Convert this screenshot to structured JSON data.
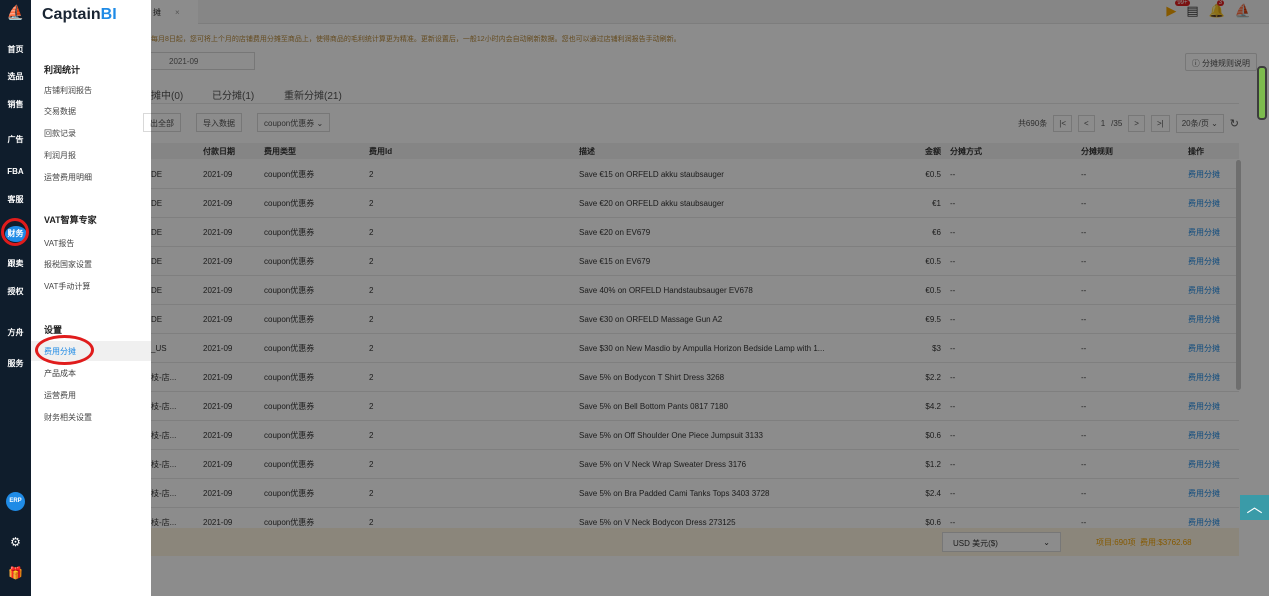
{
  "rail": {
    "items": [
      "首页",
      "选品",
      "销售",
      "广告",
      "FBA",
      "客服",
      "财务",
      "跟卖",
      "授权",
      "方舟",
      "服务"
    ],
    "erp": "ERP"
  },
  "panel": {
    "brand_main": "Captain",
    "brand_accent": "BI",
    "sections": [
      {
        "title": "利润统计",
        "links": [
          "店铺利润报告",
          "交易数据",
          "回款记录",
          "利润月报",
          "运营费用明细"
        ]
      },
      {
        "title": "VAT智算专家",
        "links": [
          "VAT报告",
          "报税国家设置",
          "VAT手动计算"
        ]
      },
      {
        "title": "设置",
        "links": [
          "费用分摊",
          "产品成本",
          "运营费用",
          "财务相关设置"
        ]
      }
    ]
  },
  "header": {
    "tab_label": "摊",
    "tab_close": "×",
    "badge": "99+",
    "bell_badge": "3"
  },
  "notice": "每月8日起，您可将上个月的店铺费用分摊至商品上，使得商品的毛利统计算更为精准。更新设置后，一般12小时内会自动刷新数据。您也可以通过店铺利润报告手动刷新。",
  "date_value": "2021-09",
  "rule_button": "分摊规则说明",
  "subtabs": [
    "摊中(0)",
    "已分摊(1)",
    "重新分摊(21)"
  ],
  "toolbar": {
    "export": "出全部",
    "import": "导入数据",
    "filter": "coupon优惠券"
  },
  "pager": {
    "total": "共690条",
    "current": "1",
    "pages": "/35",
    "size": "20条/页"
  },
  "table": {
    "headers": [
      "付款日期",
      "费用类型",
      "费用Id",
      "描述",
      "金额",
      "分摊方式",
      "分摊规则",
      "操作"
    ],
    "rows": [
      [
        "DE",
        "2021-09",
        "coupon优惠券",
        "2",
        "Save €15 on ORFELD akku staubsauger",
        "€0.5",
        "--",
        "--",
        "费用分摊"
      ],
      [
        "DE",
        "2021-09",
        "coupon优惠券",
        "2",
        "Save €20 on ORFELD akku staubsauger",
        "€1",
        "--",
        "--",
        "费用分摊"
      ],
      [
        "DE",
        "2021-09",
        "coupon优惠券",
        "2",
        "Save €20 on EV679",
        "€6",
        "--",
        "--",
        "费用分摊"
      ],
      [
        "DE",
        "2021-09",
        "coupon优惠券",
        "2",
        "Save €15 on EV679",
        "€0.5",
        "--",
        "--",
        "费用分摊"
      ],
      [
        "DE",
        "2021-09",
        "coupon优惠券",
        "2",
        "Save 40% on ORFELD Handstaubsauger EV678",
        "€0.5",
        "--",
        "--",
        "费用分摊"
      ],
      [
        "DE",
        "2021-09",
        "coupon优惠券",
        "2",
        "Save €30 on ORFELD Massage Gun A2",
        "€9.5",
        "--",
        "--",
        "费用分摊"
      ],
      [
        "_US",
        "2021-09",
        "coupon优惠券",
        "2",
        "Save $30 on New Masdio by Ampulla Horizon Bedside Lamp with 1...",
        "$3",
        "--",
        "--",
        "费用分摊"
      ],
      [
        "枝-店...",
        "2021-09",
        "coupon优惠券",
        "2",
        "Save 5% on Bodycon T Shirt Dress 3268",
        "$2.2",
        "--",
        "--",
        "费用分摊"
      ],
      [
        "枝-店...",
        "2021-09",
        "coupon优惠券",
        "2",
        "Save 5% on Bell Bottom Pants 0817 7180",
        "$4.2",
        "--",
        "--",
        "费用分摊"
      ],
      [
        "枝-店...",
        "2021-09",
        "coupon优惠券",
        "2",
        "Save 5% on Off Shoulder One Piece Jumpsuit 3133",
        "$0.6",
        "--",
        "--",
        "费用分摊"
      ],
      [
        "枝-店...",
        "2021-09",
        "coupon优惠券",
        "2",
        "Save 5% on V Neck Wrap Sweater Dress 3176",
        "$1.2",
        "--",
        "--",
        "费用分摊"
      ],
      [
        "枝-店...",
        "2021-09",
        "coupon优惠券",
        "2",
        "Save 5% on Bra Padded Cami Tanks Tops 3403 3728",
        "$2.4",
        "--",
        "--",
        "费用分摊"
      ],
      [
        "枝-店...",
        "2021-09",
        "coupon优惠券",
        "2",
        "Save 5% on V Neck Bodycon Dress 273125",
        "$0.6",
        "--",
        "--",
        "费用分摊"
      ]
    ]
  },
  "summary": {
    "currency": "USD 美元($)",
    "items": "项目:690项",
    "cost": "费用:$3762.68"
  },
  "colors": {
    "accent": "#1f8be6",
    "highlight": "#e01c1c",
    "rail": "#0f1d2c"
  }
}
